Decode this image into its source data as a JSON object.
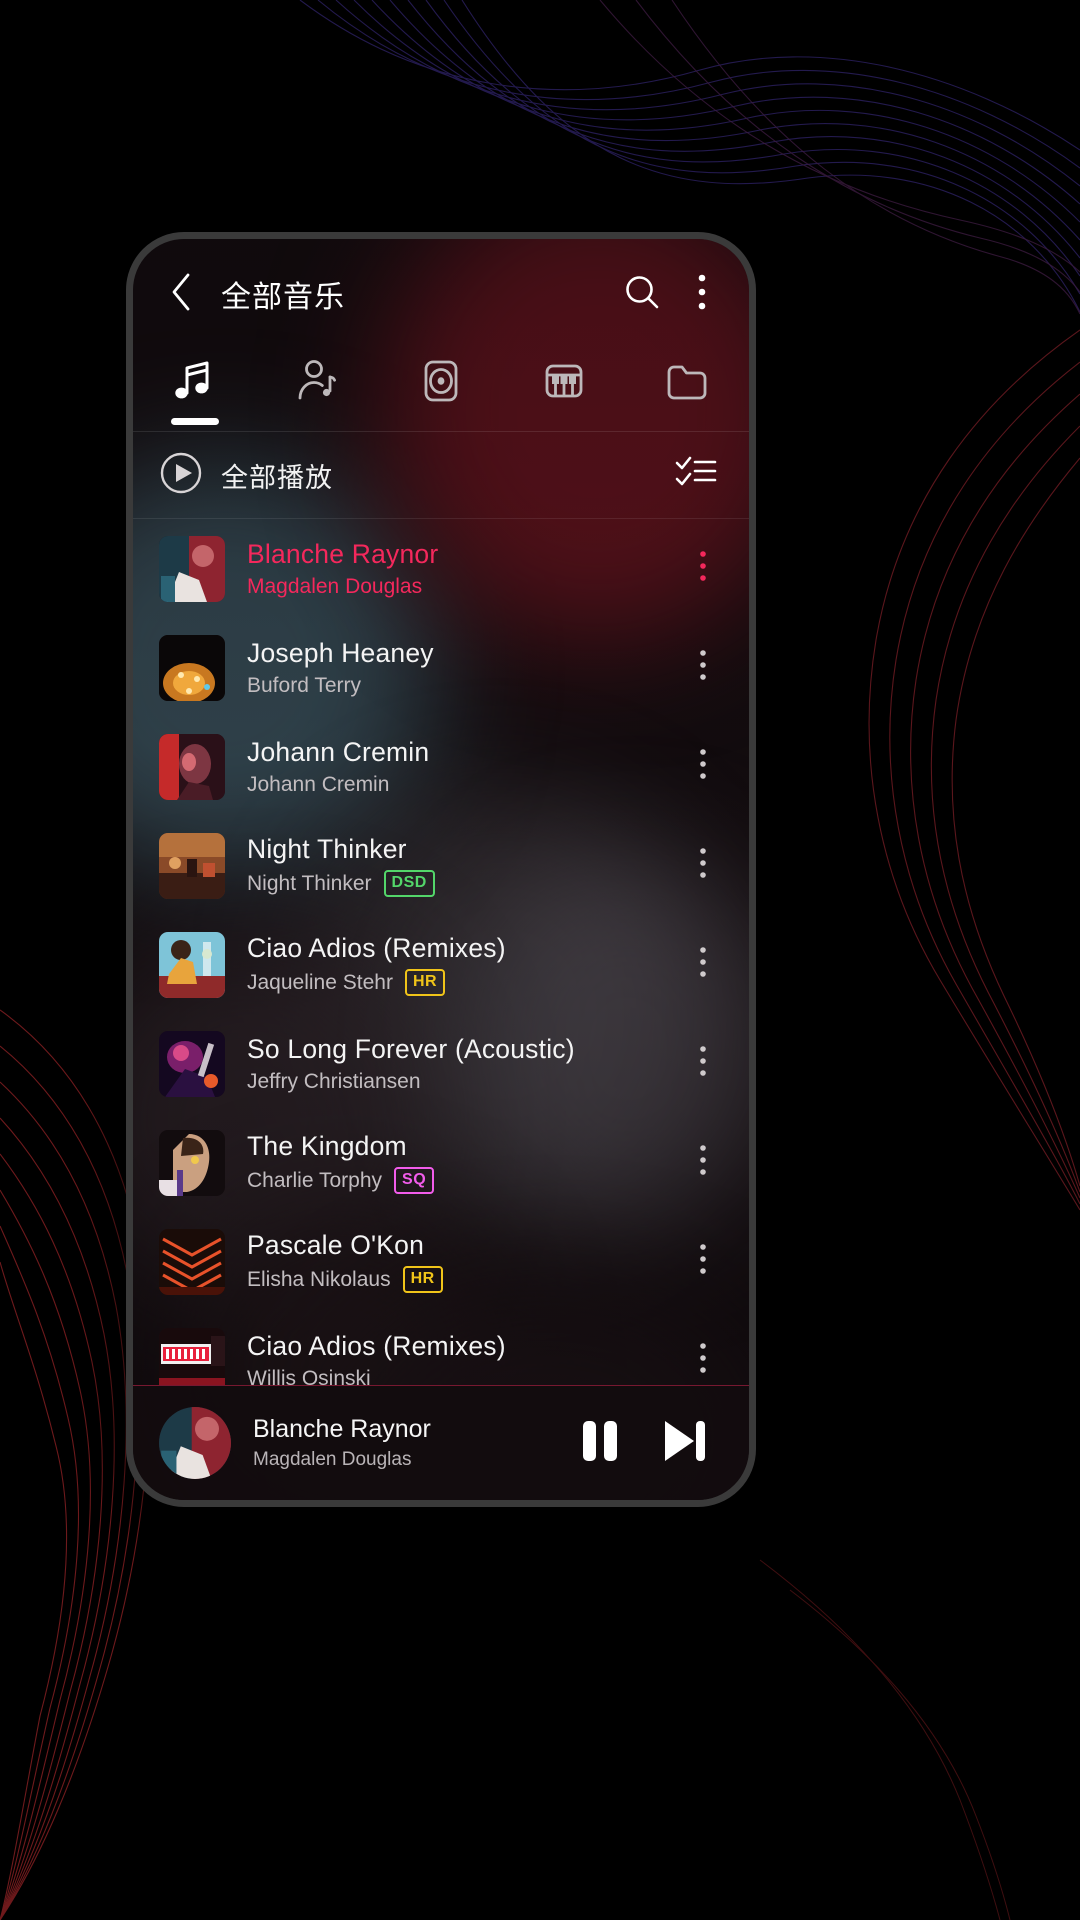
{
  "app": {
    "background_color": "#000000",
    "accent_color": "#f4285c"
  },
  "header": {
    "back_icon": "chevron-left-icon",
    "title": "全部音乐",
    "search_icon": "search-icon",
    "overflow_icon": "more-vertical-icon"
  },
  "tabs": [
    {
      "name": "songs",
      "icon": "music-note-icon",
      "active": true
    },
    {
      "name": "artists",
      "icon": "artist-icon",
      "active": false
    },
    {
      "name": "albums",
      "icon": "album-disc-icon",
      "active": false
    },
    {
      "name": "genres",
      "icon": "piano-keys-icon",
      "active": false
    },
    {
      "name": "folders",
      "icon": "folder-icon",
      "active": false
    }
  ],
  "play_all": {
    "icon": "play-circle-icon",
    "label": "全部播放",
    "multiselect_icon": "checklist-icon"
  },
  "songs": [
    {
      "title": "Blanche Raynor",
      "artist": "Magdalen Douglas",
      "badge": "",
      "active": true,
      "art": "a1"
    },
    {
      "title": "Joseph Heaney",
      "artist": "Buford Terry",
      "badge": "",
      "active": false,
      "art": "a2"
    },
    {
      "title": "Johann Cremin",
      "artist": "Johann Cremin",
      "badge": "",
      "active": false,
      "art": "a3"
    },
    {
      "title": "Night Thinker",
      "artist": "Night Thinker",
      "badge": "DSD",
      "active": false,
      "art": "a4"
    },
    {
      "title": "Ciao Adios (Remixes)",
      "artist": "Jaqueline Stehr",
      "badge": "HR",
      "active": false,
      "art": "a5"
    },
    {
      "title": "So Long Forever (Acoustic)",
      "artist": "Jeffry Christiansen",
      "badge": "",
      "active": false,
      "art": "a6"
    },
    {
      "title": "The Kingdom",
      "artist": "Charlie Torphy",
      "badge": "SQ",
      "active": false,
      "art": "a7"
    },
    {
      "title": "Pascale O'Kon",
      "artist": "Elisha Nikolaus",
      "badge": "HR",
      "active": false,
      "art": "a8"
    },
    {
      "title": "Ciao Adios (Remixes)",
      "artist": "Willis Osinski",
      "badge": "",
      "active": false,
      "art": "a9"
    }
  ],
  "badge_colors": {
    "DSD": "#53d66a",
    "HR": "#f0c419",
    "SQ": "#f25ceb"
  },
  "mini_player": {
    "title": "Blanche Raynor",
    "artist": "Magdalen Douglas",
    "pause_icon": "pause-icon",
    "next_icon": "skip-next-icon",
    "art": "a1"
  }
}
